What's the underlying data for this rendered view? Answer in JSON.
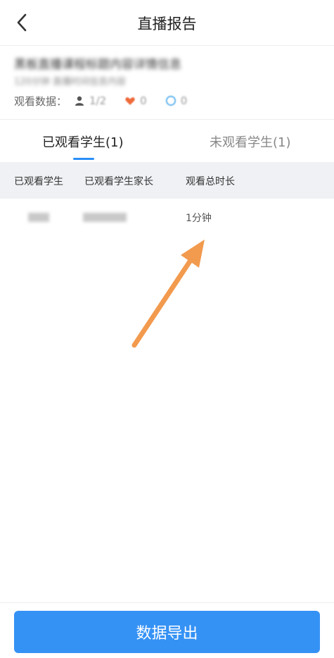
{
  "nav": {
    "title": "直播报告"
  },
  "summary": {
    "line1": "黑板直播课程标题内容详情信息",
    "line2": "120分钟 直播时间信息内容",
    "stats_label": "观看数据：",
    "viewers_value": "1/2",
    "likes_value": "0",
    "comments_value": "0"
  },
  "tabs": [
    {
      "label": "已观看学生(1)"
    },
    {
      "label": "未观看学生(1)"
    }
  ],
  "table": {
    "headers": [
      "已观看学生",
      "已观看学生家长",
      "观看总时长"
    ],
    "rows": [
      {
        "student": "学生",
        "parent": "家长姓名",
        "duration": "1分钟"
      }
    ]
  },
  "footer": {
    "export_label": "数据导出"
  },
  "colors": {
    "accent": "#3592f5",
    "arrow": "#f29a4e",
    "header_bg": "#eff1f4"
  }
}
